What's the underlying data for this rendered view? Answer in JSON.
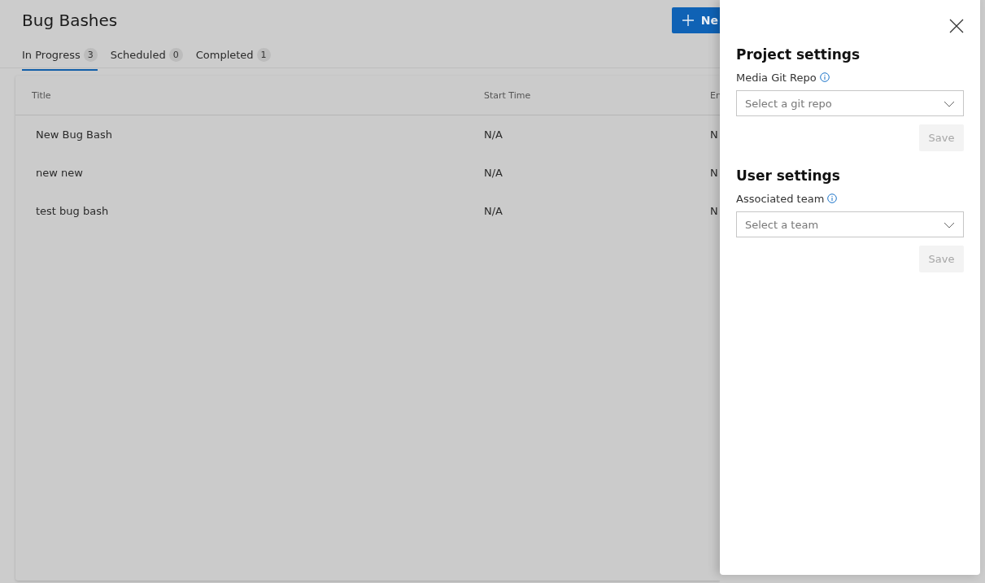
{
  "page": {
    "title": "Bug Bashes",
    "new_button": {
      "label": "Ne"
    },
    "tabs": [
      {
        "label": "In Progress",
        "count": "3",
        "selected": true
      },
      {
        "label": "Scheduled",
        "count": "0",
        "selected": false
      },
      {
        "label": "Completed",
        "count": "1",
        "selected": false
      }
    ]
  },
  "table": {
    "columns": [
      "Title",
      "Start Time",
      "En"
    ],
    "rows": [
      [
        "New Bug Bash",
        "N/A",
        "N"
      ],
      [
        "new new",
        "N/A",
        "N"
      ],
      [
        "test bug bash",
        "N/A",
        "N"
      ]
    ]
  },
  "settings_panel": {
    "sections": [
      {
        "heading": "Project settings",
        "field_label": "Media Git Repo",
        "placeholder": "Select a git repo",
        "save": {
          "label": "Save",
          "disabled": true
        }
      },
      {
        "heading": "User settings",
        "field_label": "Associated team",
        "placeholder": "Select a team",
        "save": {
          "label": "Save",
          "disabled": true
        }
      }
    ]
  }
}
